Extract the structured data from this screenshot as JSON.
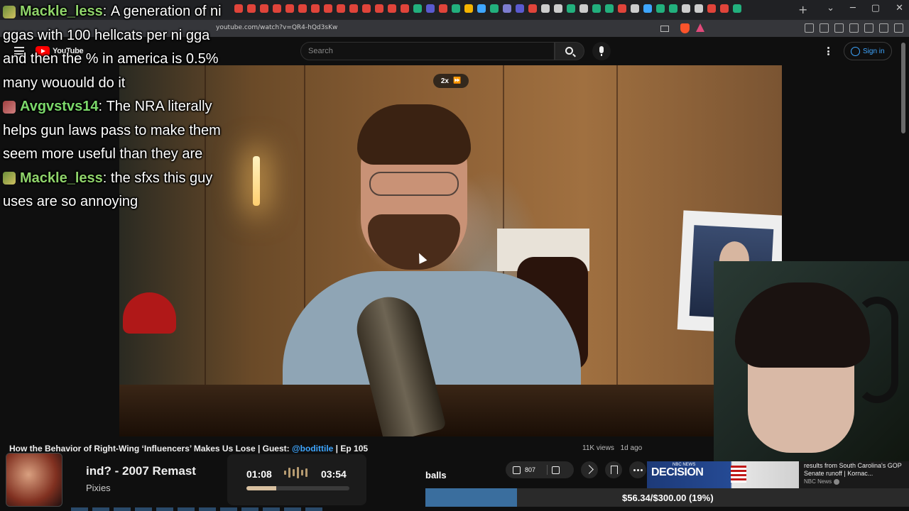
{
  "browser": {
    "url": "youtube.com/watch?v=QR4-hQd3sKw",
    "tab_icon_colors": [
      "#e0443a",
      "#e0443a",
      "#e0443a",
      "#e0443a",
      "#e0443a",
      "#e0443a",
      "#e0443a",
      "#e0443a",
      "#e0443a",
      "#e0443a",
      "#e0443a",
      "#e0443a",
      "#e0443a",
      "#e0443a",
      "#22b07d",
      "#5a5acf",
      "#e0443a",
      "#22b07d",
      "#f5b400",
      "#3ea6ff",
      "#22b07d",
      "#7d7dcf",
      "#5a5acf",
      "#e0443a",
      "#cccccc",
      "#cccccc",
      "#22b07d",
      "#cccccc",
      "#22b07d",
      "#22b07d",
      "#e0443a",
      "#cccccc",
      "#3ea6ff",
      "#22b07d",
      "#22b07d",
      "#cccccc",
      "#cccccc",
      "#e0443a",
      "#e0443a",
      "#22b07d"
    ],
    "new_tab_symbol": "+",
    "window_controls": [
      "⌄",
      "─",
      "▢",
      "✕"
    ]
  },
  "youtube": {
    "logo_text": "YouTube",
    "search": {
      "placeholder": "Search"
    },
    "signin_label": "Sign in"
  },
  "video": {
    "speed_label": "2x",
    "speed_icon": "fast-forward-icon",
    "title_prefix": "How the Behavior of Right-Wing ‘Influencers’ Makes Us Lose | Guest: ",
    "title_guest": "@boditti​le",
    "title_suffix": " | Ep 105",
    "views": "11K views",
    "age": "1d ago",
    "likes": "807"
  },
  "chat": [
    {
      "user": "Mackle_less",
      "message": "A generation of ni",
      "badge": "default"
    },
    {
      "user": "",
      "message": "ggas with 100 hellcats per ni gga",
      "badge": "none"
    },
    {
      "user": "",
      "message": "and then the % in america is 0.5%",
      "badge": "none"
    },
    {
      "user": "",
      "message": "many wouould do it",
      "badge": "none"
    },
    {
      "user": "Avgvstvs14",
      "message": "The NRA literally",
      "badge": "alt"
    },
    {
      "user": "",
      "message": "helps gun laws pass to make them",
      "badge": "none"
    },
    {
      "user": "",
      "message": "seem more useful than they are",
      "badge": "none"
    },
    {
      "user": "Mackle_less",
      "message": "the sfxs this guy",
      "badge": "default"
    },
    {
      "user": "",
      "message": "uses are so annoying",
      "badge": "none"
    }
  ],
  "music": {
    "song_title": "ind? - 2007 Remast",
    "artist": "Pixies",
    "current_time": "01:08",
    "total_time": "03:54",
    "progress": 0.29
  },
  "overlay_text": "balls",
  "donation": {
    "label": "$56.34/$300.00 (19%)",
    "progress": 0.19
  },
  "news_card": {
    "badge": "NBC NEWS",
    "thumb_text": "DECISION",
    "title": "results from South Carolina's GOP Senate runoff | Kornac...",
    "channel": "NBC News"
  },
  "colors": {
    "accent_blue": "#3ea6ff",
    "chat_username": "#8fd36a",
    "donation_fill": "#3a6e9e"
  }
}
